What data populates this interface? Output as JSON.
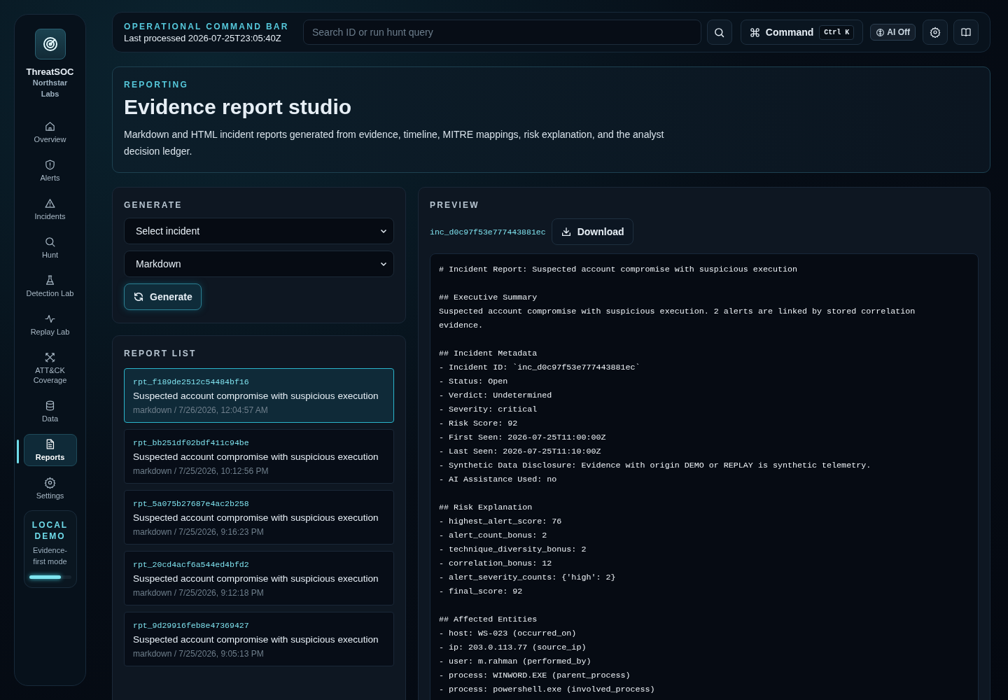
{
  "sidebar": {
    "brand": "ThreatSOC",
    "org": "Northstar Labs",
    "nav": [
      {
        "label": "Overview",
        "selected": false
      },
      {
        "label": "Alerts",
        "selected": false
      },
      {
        "label": "Incidents",
        "selected": false
      },
      {
        "label": "Hunt",
        "selected": false
      },
      {
        "label": "Detection Lab",
        "selected": false
      },
      {
        "label": "Replay Lab",
        "selected": false
      },
      {
        "label": "ATT&CK Coverage",
        "selected": false
      },
      {
        "label": "Data",
        "selected": false
      },
      {
        "label": "Reports",
        "selected": true
      },
      {
        "label": "Settings",
        "selected": false
      }
    ],
    "mode_card": {
      "title": "LOCAL DEMO",
      "subtitle": "Evidence-first mode",
      "level": 0.75
    }
  },
  "command_bar": {
    "eyebrow": "OPERATIONAL COMMAND BAR",
    "status": "Last processed 2026-07-25T23:05:40Z",
    "search": {
      "placeholder": "Search ID or run hunt query"
    },
    "command_button": "Command",
    "shortcut": "Ctrl K",
    "ai_toggle": {
      "label": "AI Off",
      "on": false
    }
  },
  "header": {
    "eyebrow": "REPORTING",
    "title": "Evidence report studio",
    "description": "Markdown and HTML incident reports generated from evidence, timeline, MITRE mappings, risk explanation, and the analyst decision ledger."
  },
  "generate": {
    "title": "GENERATE",
    "incident_select": "Select incident",
    "format_select": "Markdown",
    "button": "Generate"
  },
  "report_list": {
    "title": "REPORT LIST",
    "items": [
      {
        "id": "rpt_f189de2512c54484bf16",
        "title": "Suspected account compromise with suspicious execution",
        "meta": "markdown / 7/26/2026, 12:04:57 AM",
        "selected": true
      },
      {
        "id": "rpt_bb251df02bdf411c94be",
        "title": "Suspected account compromise with suspicious execution",
        "meta": "markdown / 7/25/2026, 10:12:56 PM",
        "selected": false
      },
      {
        "id": "rpt_5a075b27687e4ac2b258",
        "title": "Suspected account compromise with suspicious execution",
        "meta": "markdown / 7/25/2026, 9:16:23 PM",
        "selected": false
      },
      {
        "id": "rpt_20cd4acf6a544ed4bfd2",
        "title": "Suspected account compromise with suspicious execution",
        "meta": "markdown / 7/25/2026, 9:12:18 PM",
        "selected": false
      },
      {
        "id": "rpt_9d29916feb8e47369427",
        "title": "Suspected account compromise with suspicious execution",
        "meta": "markdown / 7/25/2026, 9:05:13 PM",
        "selected": false
      }
    ]
  },
  "preview": {
    "title": "PREVIEW",
    "incident_id": "inc_d0c97f53e777443881ec",
    "download": "Download",
    "content": "# Incident Report: Suspected account compromise with suspicious execution\n\n## Executive Summary\nSuspected account compromise with suspicious execution. 2 alerts are linked by stored correlation\nevidence.\n\n## Incident Metadata\n- Incident ID: `inc_d0c97f53e777443881ec`\n- Status: Open\n- Verdict: Undetermined\n- Severity: critical\n- Risk Score: 92\n- First Seen: 2026-07-25T11:00:00Z\n- Last Seen: 2026-07-25T11:10:00Z\n- Synthetic Data Disclosure: Evidence with origin DEMO or REPLAY is synthetic telemetry.\n- AI Assistance Used: no\n\n## Risk Explanation\n- highest_alert_score: 76\n- alert_count_bonus: 2\n- technique_diversity_bonus: 2\n- correlation_bonus: 12\n- alert_severity_counts: {'high': 2}\n- final_score: 92\n\n## Affected Entities\n- host: WS-023 (occurred_on)\n- ip: 203.0.113.77 (source_ip)\n- user: m.rahman (performed_by)\n- process: WINWORD.EXE (parent_process)\n- process: powershell.exe (involved_process)"
  }
}
